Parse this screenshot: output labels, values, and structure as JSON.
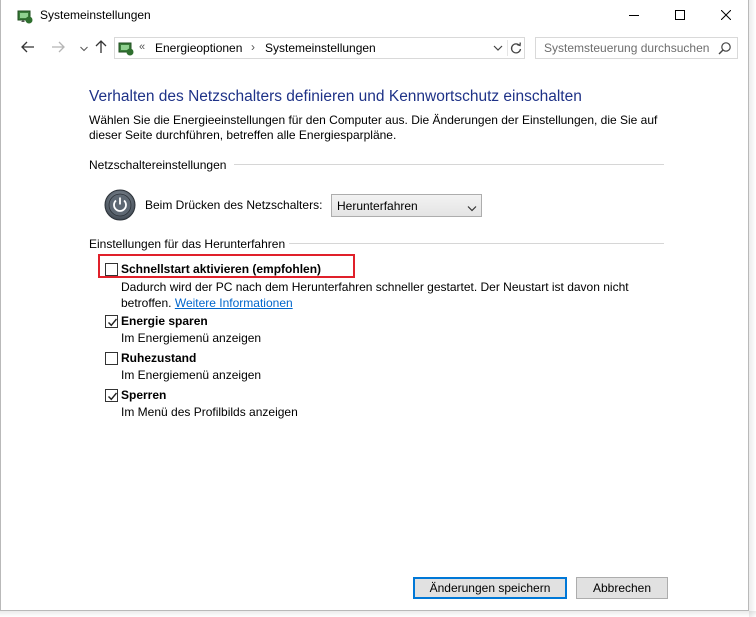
{
  "window": {
    "title": "Systemeinstellungen"
  },
  "address_bar": {
    "breadcrumb_prefix": "«",
    "breadcrumbs": [
      "Energieoptionen",
      "Systemeinstellungen"
    ],
    "separator": "›"
  },
  "search": {
    "placeholder": "Systemsteuerung durchsuchen"
  },
  "main": {
    "heading": "Verhalten des Netzschalters definieren und Kennwortschutz einschalten",
    "intro": "Wählen Sie die Energieeinstellungen für den Computer aus. Die Änderungen der Einstellungen, die Sie auf dieser Seite durchführen, betreffen alle Energiesparpläne.",
    "power_section": {
      "title": "Netzschaltereinstellungen",
      "label": "Beim Drücken des Netzschalters:",
      "selected": "Herunterfahren"
    },
    "shutdown_section": {
      "title": "Einstellungen für das Herunterfahren",
      "options": [
        {
          "label": "Schnellstart aktivieren (empfohlen)",
          "checked": false,
          "desc": "Dadurch wird der PC nach dem Herunterfahren schneller gestartet. Der Neustart ist davon nicht betroffen.",
          "link": "Weitere Informationen"
        },
        {
          "label": "Energie sparen",
          "checked": true,
          "desc": "Im Energiemenü anzeigen"
        },
        {
          "label": "Ruhezustand",
          "checked": false,
          "desc": "Im Energiemenü anzeigen"
        },
        {
          "label": "Sperren",
          "checked": true,
          "desc": "Im Menü des Profilbilds anzeigen"
        }
      ]
    }
  },
  "buttons": {
    "save": "Änderungen speichern",
    "cancel": "Abbrechen"
  },
  "colors": {
    "heading": "#1e3287",
    "link": "#0066cc",
    "highlight": "#e0202a",
    "primary_button_border": "#0078d7"
  }
}
